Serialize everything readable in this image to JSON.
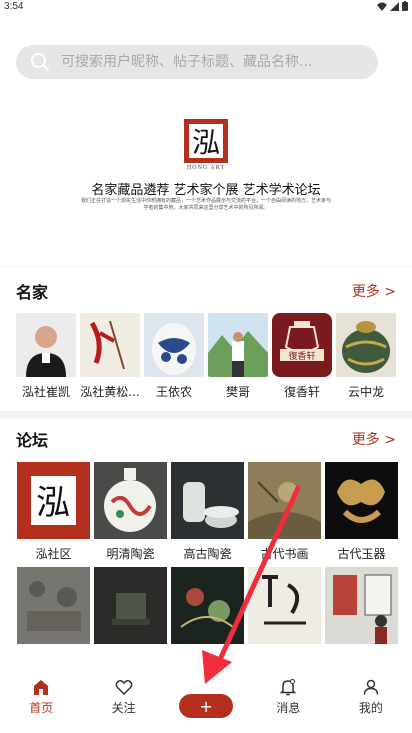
{
  "status": {
    "time": "3:54"
  },
  "search": {
    "placeholder": "可搜索用户昵称、帖子标题、藏品名称..."
  },
  "hero": {
    "logo_glyph": "泓",
    "logo_sub": "HONG ART",
    "slogan": "名家藏品遴荐 艺术家个展 艺术学术论坛",
    "description": "我们正在打造一个现实生活中你想拥有的藏品，一个艺术作品展示与交流的平台，一个自由阅读的地方，艺术家与学者的集中地，大家共同来这里分享艺术中的所见所闻。"
  },
  "masters": {
    "title": "名家",
    "more": "更多 >",
    "items": [
      {
        "label": "泓社崔凯",
        "icon": "portrait"
      },
      {
        "label": "泓社黄松...",
        "icon": "calligraphy"
      },
      {
        "label": "王依农",
        "icon": "porcelain"
      },
      {
        "label": "樊哥",
        "icon": "portrait-landscape"
      },
      {
        "label": "復香轩",
        "icon": "seal-logo"
      },
      {
        "label": "云中龙",
        "icon": "cloisonne"
      }
    ]
  },
  "forum": {
    "title": "论坛",
    "more": "更多 >",
    "row1": [
      {
        "label": "泓社区",
        "icon": "hong-logo"
      },
      {
        "label": "明清陶瓷",
        "icon": "vase"
      },
      {
        "label": "高古陶瓷",
        "icon": "pottery"
      },
      {
        "label": "古代书画",
        "icon": "painting"
      },
      {
        "label": "古代玉器",
        "icon": "jade"
      }
    ],
    "row2": [
      {
        "label": "",
        "icon": "stone-relief"
      },
      {
        "label": "",
        "icon": "bronze"
      },
      {
        "label": "",
        "icon": "embroidery"
      },
      {
        "label": "",
        "icon": "calligraphy"
      },
      {
        "label": "",
        "icon": "exhibition"
      }
    ]
  },
  "tabs": [
    {
      "label": "首页",
      "icon": "home-icon",
      "active": true
    },
    {
      "label": "关注",
      "icon": "heart-icon",
      "active": false
    },
    {
      "label": "+",
      "icon": "plus-icon",
      "active": false
    },
    {
      "label": "消息",
      "icon": "bell-icon",
      "active": false
    },
    {
      "label": "我的",
      "icon": "user-icon",
      "active": false
    }
  ],
  "colors": {
    "accent": "#b2301d",
    "arrow": "#ef2d3c"
  }
}
